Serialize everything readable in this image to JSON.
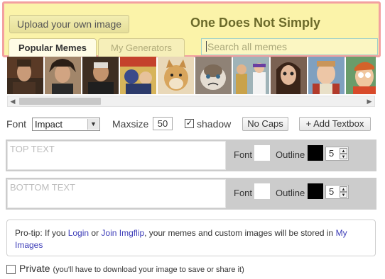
{
  "header": {
    "upload_button": "Upload your own image",
    "title": "One Does Not Simply",
    "tabs": [
      {
        "label": "Popular Memes",
        "active": true
      },
      {
        "label": "My Generators",
        "active": false
      }
    ],
    "search_placeholder": "Search all memes"
  },
  "thumbnails": [
    {
      "name": "one-does-not-simply",
      "color": "#6b4a32"
    },
    {
      "name": "ancient-aliens",
      "color": "#8c6a4a"
    },
    {
      "name": "most-interesting-man",
      "color": "#5a4634"
    },
    {
      "name": "batman-slapping-robin",
      "color": "#c9a34a"
    },
    {
      "name": "doge",
      "color": "#d9b77a"
    },
    {
      "name": "grumpy-cat",
      "color": "#a89a8c"
    },
    {
      "name": "x-x-everywhere",
      "color": "#6f7c5a"
    },
    {
      "name": "overly-attached-girlfriend",
      "color": "#6a4838"
    },
    {
      "name": "bad-luck-brian",
      "color": "#a44a3a"
    },
    {
      "name": "futurama-fry",
      "color": "#c86a2a"
    }
  ],
  "toolbar": {
    "font_label": "Font",
    "font_value": "Impact",
    "maxsize_label": "Maxsize",
    "maxsize_value": "50",
    "shadow_label": "shadow",
    "shadow_checked": true,
    "nocaps_button": "No Caps",
    "add_textbox_button": "+ Add Textbox"
  },
  "textboxes": [
    {
      "placeholder": "TOP TEXT",
      "font_label": "Font",
      "outline_label": "Outline",
      "outline_size": "5"
    },
    {
      "placeholder": "BOTTOM TEXT",
      "font_label": "Font",
      "outline_label": "Outline",
      "outline_size": "5"
    }
  ],
  "protip": {
    "prefix": "Pro-tip: If you ",
    "login": "Login",
    "or": " or ",
    "join": "Join Imgflip",
    "middle": ", your memes and custom images will be stored in ",
    "my_images": "My Images"
  },
  "private": {
    "label": "Private",
    "note": "(you'll have to download your image to save or share it)",
    "checked": false
  }
}
